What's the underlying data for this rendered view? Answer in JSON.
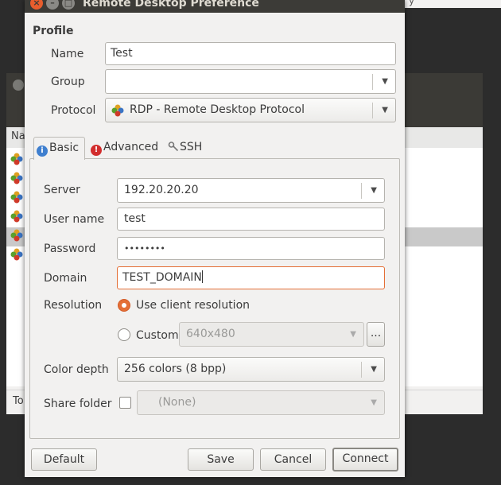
{
  "dialog": {
    "title": "Remote Desktop Preference",
    "window_buttons": {
      "close": "×",
      "minimize": "–",
      "maximize": "□"
    }
  },
  "profile": {
    "section_title": "Profile",
    "name_label": "Name",
    "name_value": "Test",
    "group_label": "Group",
    "group_value": "",
    "protocol_label": "Protocol",
    "protocol_value": "RDP - Remote Desktop Protocol"
  },
  "tabs": [
    {
      "label": "Basic",
      "icon": "info-icon",
      "active": true
    },
    {
      "label": "Advanced",
      "icon": "warning-icon",
      "active": false
    },
    {
      "label": "SSH",
      "icon": "key-icon",
      "active": false
    }
  ],
  "basic": {
    "server_label": "Server",
    "server_value": "192.20.20.20",
    "username_label": "User name",
    "username_value": "test",
    "password_label": "Password",
    "password_value": "••••••••",
    "domain_label": "Domain",
    "domain_value": "TEST_DOMAIN",
    "resolution_label": "Resolution",
    "use_client_label": "Use client resolution",
    "custom_label": "Custom",
    "custom_value": "640x480",
    "custom_more": "...",
    "color_depth_label": "Color depth",
    "color_depth_value": "256 colors (8 bpp)",
    "share_folder_label": "Share folder",
    "share_folder_value": "(None)"
  },
  "buttons": {
    "default": "Default",
    "save": "Save",
    "cancel": "Cancel",
    "connect": "Connect"
  },
  "background": {
    "column_header_fragment": "Na",
    "status_fragment": "To",
    "topbar_fragment": "y"
  },
  "colors": {
    "accent": "#e46f36",
    "titlebar": "#3c3b37",
    "dialog_bg": "#f2f1f0"
  }
}
